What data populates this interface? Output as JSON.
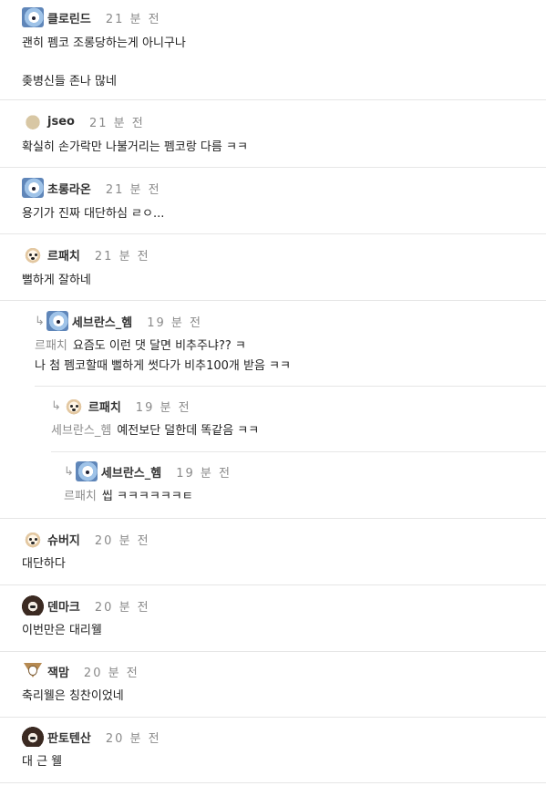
{
  "comments": [
    {
      "nick": "클로린드",
      "time": "21 분 전",
      "lines": [
        "괜히 펨코 조롱당하는게 아니구나",
        "",
        "좆병신들 존나 많네"
      ]
    },
    {
      "nick": "jseo",
      "time": "21 분 전",
      "lines": [
        "확실히 손가락만 나불거리는 펨코랑 다름 ㅋㅋ"
      ]
    },
    {
      "nick": "초롱라온",
      "time": "21 분 전",
      "lines": [
        "용기가 진짜 대단하심 ㄹㅇ..."
      ]
    },
    {
      "nick": "르패치",
      "time": "21 분 전",
      "lines": [
        "뻘하게 잘하네"
      ]
    },
    {
      "nick": "세브란스_헴",
      "time": "19 분 전",
      "mention": "르패치",
      "lines": [
        "요즘도 이런 댓 달면 비추주냐?? ㅋ",
        "나 첨 펨코할때 뻘하게 썻다가 비추100개 받음 ㅋㅋ"
      ]
    },
    {
      "nick": "르패치",
      "time": "19 분 전",
      "mention": "세브란스_헴",
      "lines": [
        "예전보단 덜한데 똑같음 ㅋㅋ"
      ]
    },
    {
      "nick": "세브란스_헴",
      "time": "19 분 전",
      "mention": "르패치",
      "lines": [
        "씹 ㅋㅋㅋㅋㅋㅋㅌ"
      ]
    },
    {
      "nick": "슈버지",
      "time": "20 분 전",
      "lines": [
        "대단하다"
      ]
    },
    {
      "nick": "덴마크",
      "time": "20 분 전",
      "lines": [
        "이번만은 대리웰"
      ]
    },
    {
      "nick": "잭맘",
      "time": "20 분 전",
      "lines": [
        "축리웰은 칭찬이었네"
      ]
    },
    {
      "nick": "판토텐산",
      "time": "20 분 전",
      "lines": [
        "대 근 웰"
      ]
    }
  ],
  "reply_arrow": "↳"
}
